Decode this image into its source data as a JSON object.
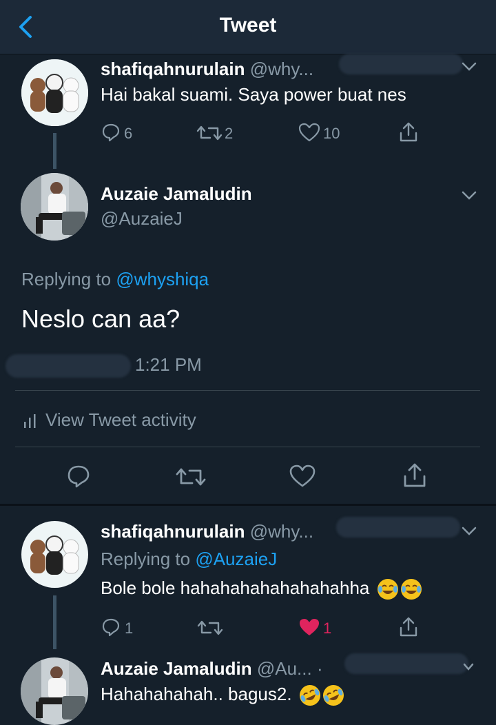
{
  "header": {
    "title": "Tweet"
  },
  "tweet1": {
    "name": "shafiqahnurulain",
    "handle": "@why...",
    "text": "Hai bakal suami. Saya power buat nes",
    "replies": "6",
    "retweets": "2",
    "likes": "10"
  },
  "main_tweet": {
    "name": "Auzaie Jamaludin",
    "handle": "@AuzaieJ",
    "replying_prefix": "Replying to",
    "replying_handle": "@whyshiqa",
    "text": "Neslo can aa?",
    "time": "1:21 PM",
    "activity_label": "View Tweet activity"
  },
  "reply1": {
    "name": "shafiqahnurulain",
    "handle": "@why...",
    "replying_prefix": "Replying to",
    "replying_handle": "@AuzaieJ",
    "text": "Bole bole hahahahahahahahahha",
    "replies": "1",
    "likes": "1",
    "emojis": [
      "face-with-tears-of-joy",
      "face-with-tears-of-joy"
    ]
  },
  "reply2": {
    "name": "Auzaie Jamaludin",
    "handle": "@Au...",
    "dot": "·",
    "text": "Hahahahahah.. bagus2.",
    "emojis": [
      "rolling-on-floor-laughing",
      "rolling-on-floor-laughing"
    ]
  },
  "colors": {
    "background": "#15202b",
    "header": "#1c2938",
    "accent": "#1da1f2",
    "muted": "#8899a6",
    "like_active": "#e0245e"
  }
}
